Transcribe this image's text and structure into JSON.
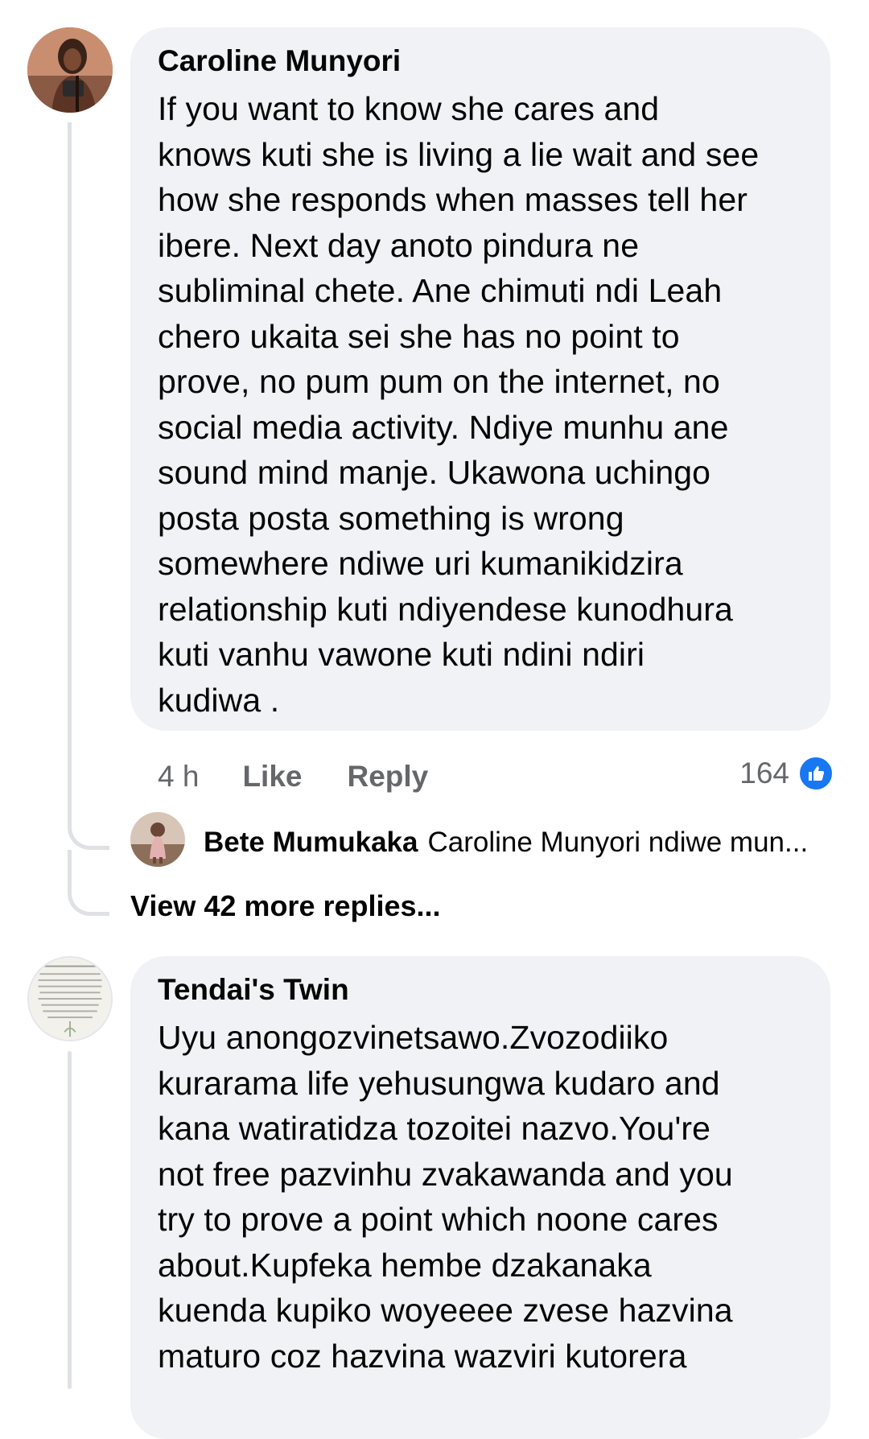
{
  "comments": [
    {
      "author": "Caroline Munyori",
      "lines": [
        "If you want to know she cares and",
        "knows kuti she is living a lie wait and see",
        "how she responds when masses tell her",
        "ibere. Next day anoto pindura ne",
        "subliminal chete. Ane chimuti ndi Leah",
        "chero ukaita sei she has no point to",
        "prove, no pum pum on the internet, no",
        "social media activity. Ndiye munhu ane",
        "sound mind manje. Ukawona uchingo",
        "posta posta something is wrong",
        "somewhere ndiwe uri kumanikidzira",
        "relationship kuti ndiyendese kunodhura",
        "kuti vanhu vawone kuti ndini ndiri",
        "kudiwa ."
      ],
      "time": "4 h",
      "like_label": "Like",
      "reply_label": "Reply",
      "reaction_count": "164",
      "reaction_icon": "thumbs-up-icon",
      "reply_preview": {
        "author": "Bete Mumukaka",
        "text": "Caroline Munyori ndiwe mun..."
      },
      "view_more_label": "View 42 more replies..."
    },
    {
      "author": "Tendai's Twin",
      "lines": [
        "Uyu anongozvinetsawo.Zvozodiiko",
        "kurarama life yehusungwa kudaro and",
        "kana watiratidza tozoitei nazvo.You're",
        "not free pazvinhu zvakawanda and you",
        "try to prove a point which noone cares",
        "about.Kupfeka hembe dzakanaka",
        "kuenda kupiko woyeeee zvese hazvina",
        "maturo coz hazvina wazviri kutorera"
      ]
    }
  ],
  "colors": {
    "bubble": "#f0f2f5",
    "secondary_text": "#65676b",
    "like_blue": "#1877f2",
    "thread_line": "#dfe1e5"
  }
}
